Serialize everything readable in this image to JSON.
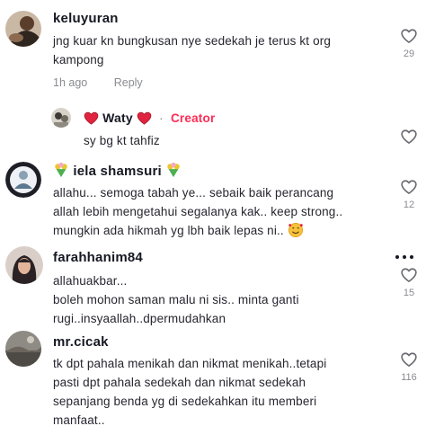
{
  "comments": [
    {
      "username": "keluyuran",
      "text": "jng kuar kn bungkusan nye sedekah je terus kt org kampong",
      "time": "1h ago",
      "reply_label": "Reply",
      "likes": "29",
      "reply": {
        "username": "Waty",
        "creator_label": "Creator",
        "text": "sy bg kt tahfiz",
        "likes": ""
      }
    },
    {
      "username": "iela shamsuri",
      "text_lines": [
        "allahu... semoga tabah ye... sebaik baik perancang",
        "allah lebih mengetahui segalanya kak.. keep strong..",
        "mungkin ada hikmah yg lbh baik lepas ni.."
      ],
      "likes": "12"
    },
    {
      "username": "farahhanim84",
      "text_lines": [
        "allahuakbar...",
        "boleh mohon saman malu ni sis.. minta ganti",
        "rugi..insyaallah..dpermudahkan"
      ],
      "likes": "15"
    },
    {
      "username": "mr.cicak",
      "text_lines": [
        "tk dpt pahala menikah dan nikmat menikah..tetapi",
        "pasti dpt pahala sedekah dan nikmat sedekah",
        "sepanjang benda yg di sedekahkan itu memberi",
        "manfaat.."
      ],
      "likes": "116"
    }
  ],
  "icons": {
    "like": "heart-outline-icon",
    "more": "more-options-icon",
    "emoji_heart": "red-heart-emoji",
    "emoji_flower": "flower-bouquet-emoji",
    "emoji_smile": "smiling-face-with-hearts-emoji"
  },
  "colors": {
    "creator_accent": "#fe2c55",
    "meta_gray": "#8a8b91",
    "text_dark": "#161823"
  }
}
